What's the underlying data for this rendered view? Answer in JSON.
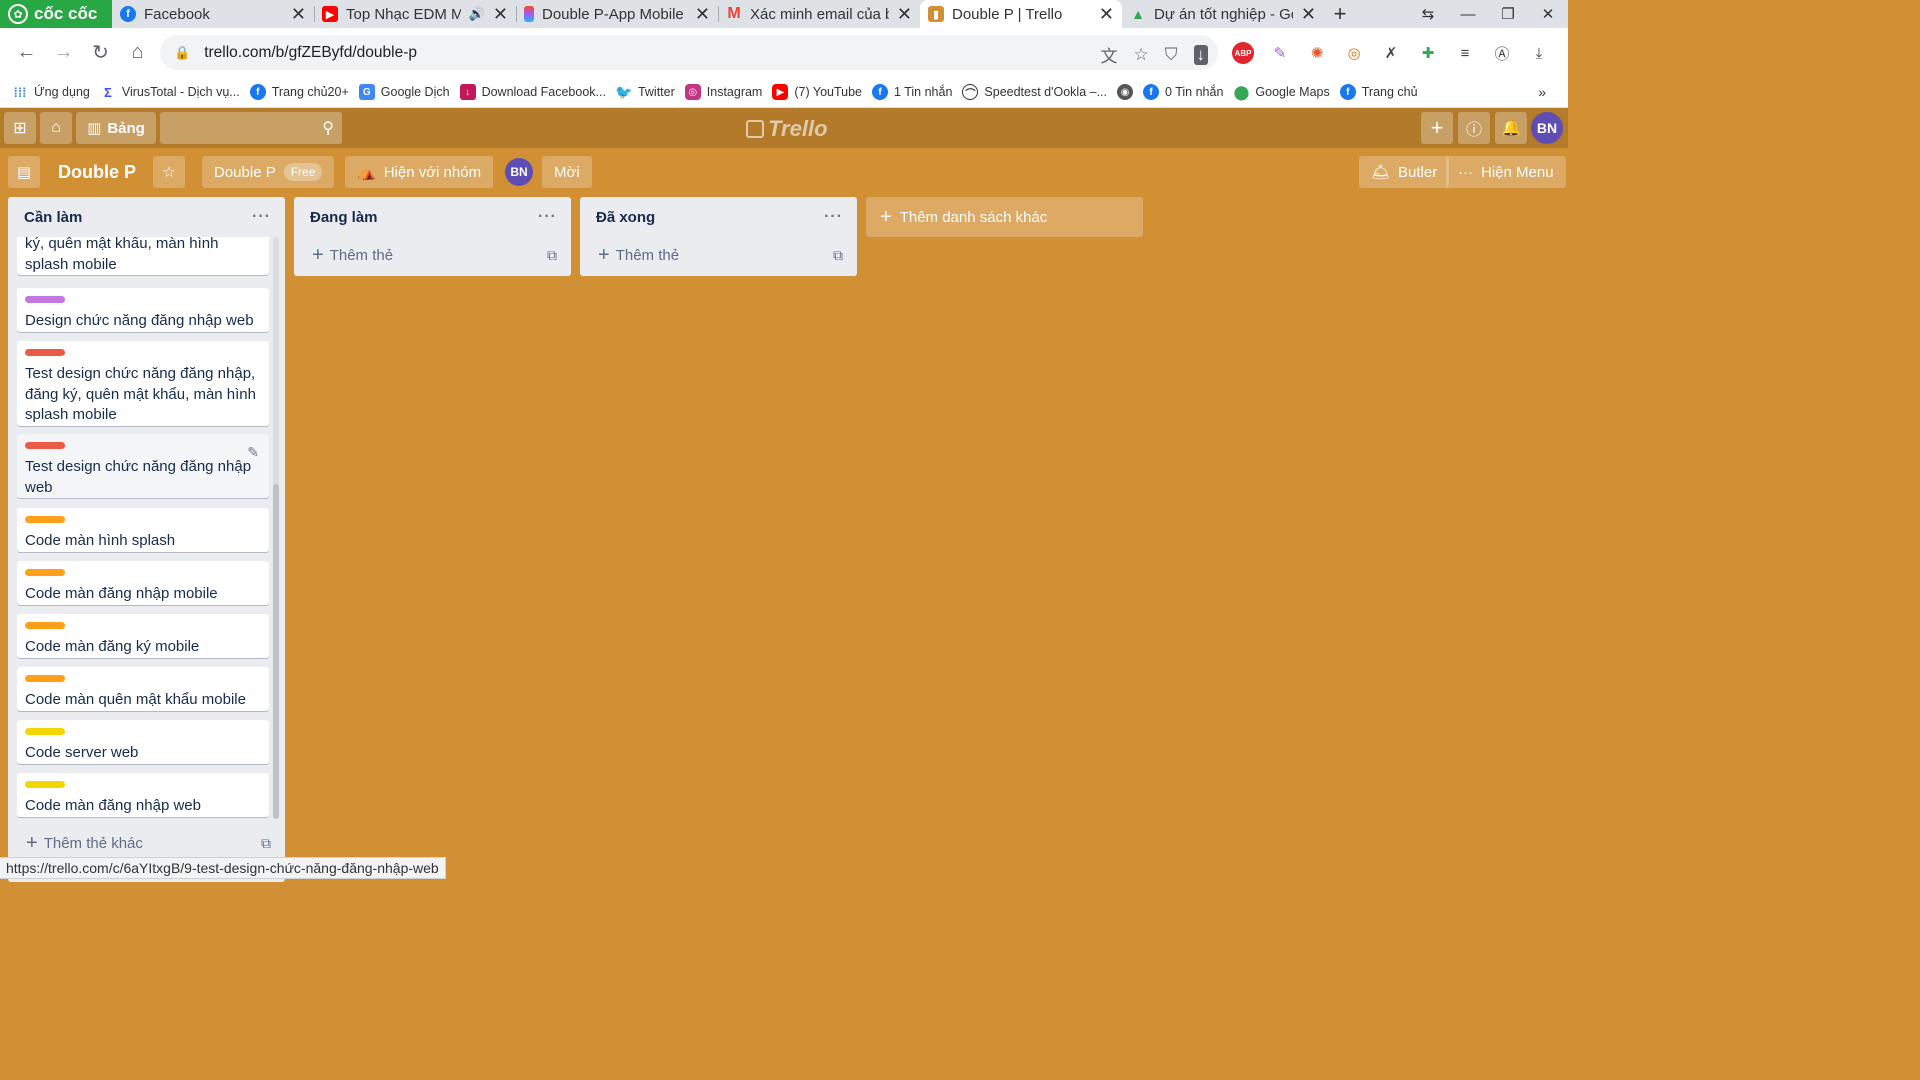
{
  "browser": {
    "brand": "cốc cốc",
    "tabs": [
      {
        "title": "Facebook",
        "favicon": "facebook-icon",
        "color": "#1877f2"
      },
      {
        "title": "Top Nhạc EDM Mix",
        "favicon": "youtube-icon",
        "color": "#ff0000"
      },
      {
        "title": "Double P-App Mobile",
        "favicon": "figma-icon",
        "color": "#a259ff"
      },
      {
        "title": "Xác minh email của bạ",
        "favicon": "gmail-icon",
        "color": "#ea4335"
      },
      {
        "title": "Double P | Trello",
        "favicon": "trello-icon",
        "color": "#d29034",
        "active": true
      },
      {
        "title": "Dự án tốt nghiệp - Goo",
        "favicon": "google-drive-icon",
        "color": "#34a853"
      }
    ],
    "url": "trello.com/b/gfZEByfd/double-p",
    "status_url": "https://trello.com/c/6aYItxgB/9-test-design-chức-năng-đăng-nhập-web"
  },
  "bookmarks": [
    {
      "label": "Ứng dụng",
      "icon": "apps-grid-icon",
      "color": "#4285f4"
    },
    {
      "label": "VirusTotal - Dịch vụ...",
      "icon": "virustotal-icon",
      "color": "#394eff"
    },
    {
      "label": "Trang chủ20+",
      "icon": "facebook-icon",
      "color": "#1877f2"
    },
    {
      "label": "Google Dịch",
      "icon": "google-translate-icon",
      "color": "#4285f4"
    },
    {
      "label": "Download Facebook...",
      "icon": "download-icon",
      "color": "#c2185b"
    },
    {
      "label": "Twitter",
      "icon": "twitter-icon",
      "color": "#1da1f2"
    },
    {
      "label": "Instagram",
      "icon": "instagram-icon",
      "color": "#c13584"
    },
    {
      "label": "(7) YouTube",
      "icon": "youtube-icon",
      "color": "#ff0000"
    },
    {
      "label": "1 Tin nhắn",
      "icon": "facebook-icon",
      "color": "#1877f2"
    },
    {
      "label": "Speedtest d'Ookla –...",
      "icon": "speedtest-icon",
      "color": "#333333"
    },
    {
      "label": "",
      "icon": "globe-icon",
      "color": "#555555"
    },
    {
      "label": "0 Tin nhắn",
      "icon": "facebook-icon",
      "color": "#1877f2"
    },
    {
      "label": "Google Maps",
      "icon": "map-pin-icon",
      "color": "#34a853"
    },
    {
      "label": "Trang chủ",
      "icon": "facebook-icon",
      "color": "#1877f2"
    }
  ],
  "trello": {
    "header": {
      "boards_label": "Bảng",
      "logo_text": "Trello",
      "user_initials": "BN"
    },
    "board": {
      "title": "Double P",
      "team_name": "Double P",
      "team_plan": "Free",
      "visibility_label": "Hiện với nhóm",
      "member_initials": "BN",
      "invite_label": "Mời",
      "butler_label": "Butler",
      "menu_label": "Hiện Menu"
    },
    "lists": [
      {
        "title": "Cần làm",
        "add_card_label": "Thêm thẻ khác",
        "cards": [
          {
            "text": "ký, quên mật khẩu, màn hình splash mobile",
            "label_color": ""
          },
          {
            "text": "Design chức năng đăng nhập web",
            "label_color": "#c377e0"
          },
          {
            "text": "Test design chức năng đăng nhập, đăng ký, quên mật khẩu, màn hình splash mobile",
            "label_color": "#eb5a46"
          },
          {
            "text": "Test design chức năng đăng nhập web",
            "label_color": "#eb5a46"
          },
          {
            "text": "Code màn hình splash",
            "label_color": "#ff9f1a"
          },
          {
            "text": "Code màn đăng nhập mobile",
            "label_color": "#ff9f1a"
          },
          {
            "text": "Code màn đăng ký mobile",
            "label_color": "#ff9f1a"
          },
          {
            "text": "Code màn quên mật khẩu mobile",
            "label_color": "#ff9f1a"
          },
          {
            "text": "Code server web",
            "label_color": "#f2d600"
          },
          {
            "text": "Code màn đăng nhập web",
            "label_color": "#f2d600"
          }
        ]
      },
      {
        "title": "Đang làm",
        "add_card_label": "Thêm thẻ",
        "cards": []
      },
      {
        "title": "Đã xong",
        "add_card_label": "Thêm thẻ",
        "cards": []
      }
    ],
    "add_list_label": "Thêm danh sách khác"
  }
}
